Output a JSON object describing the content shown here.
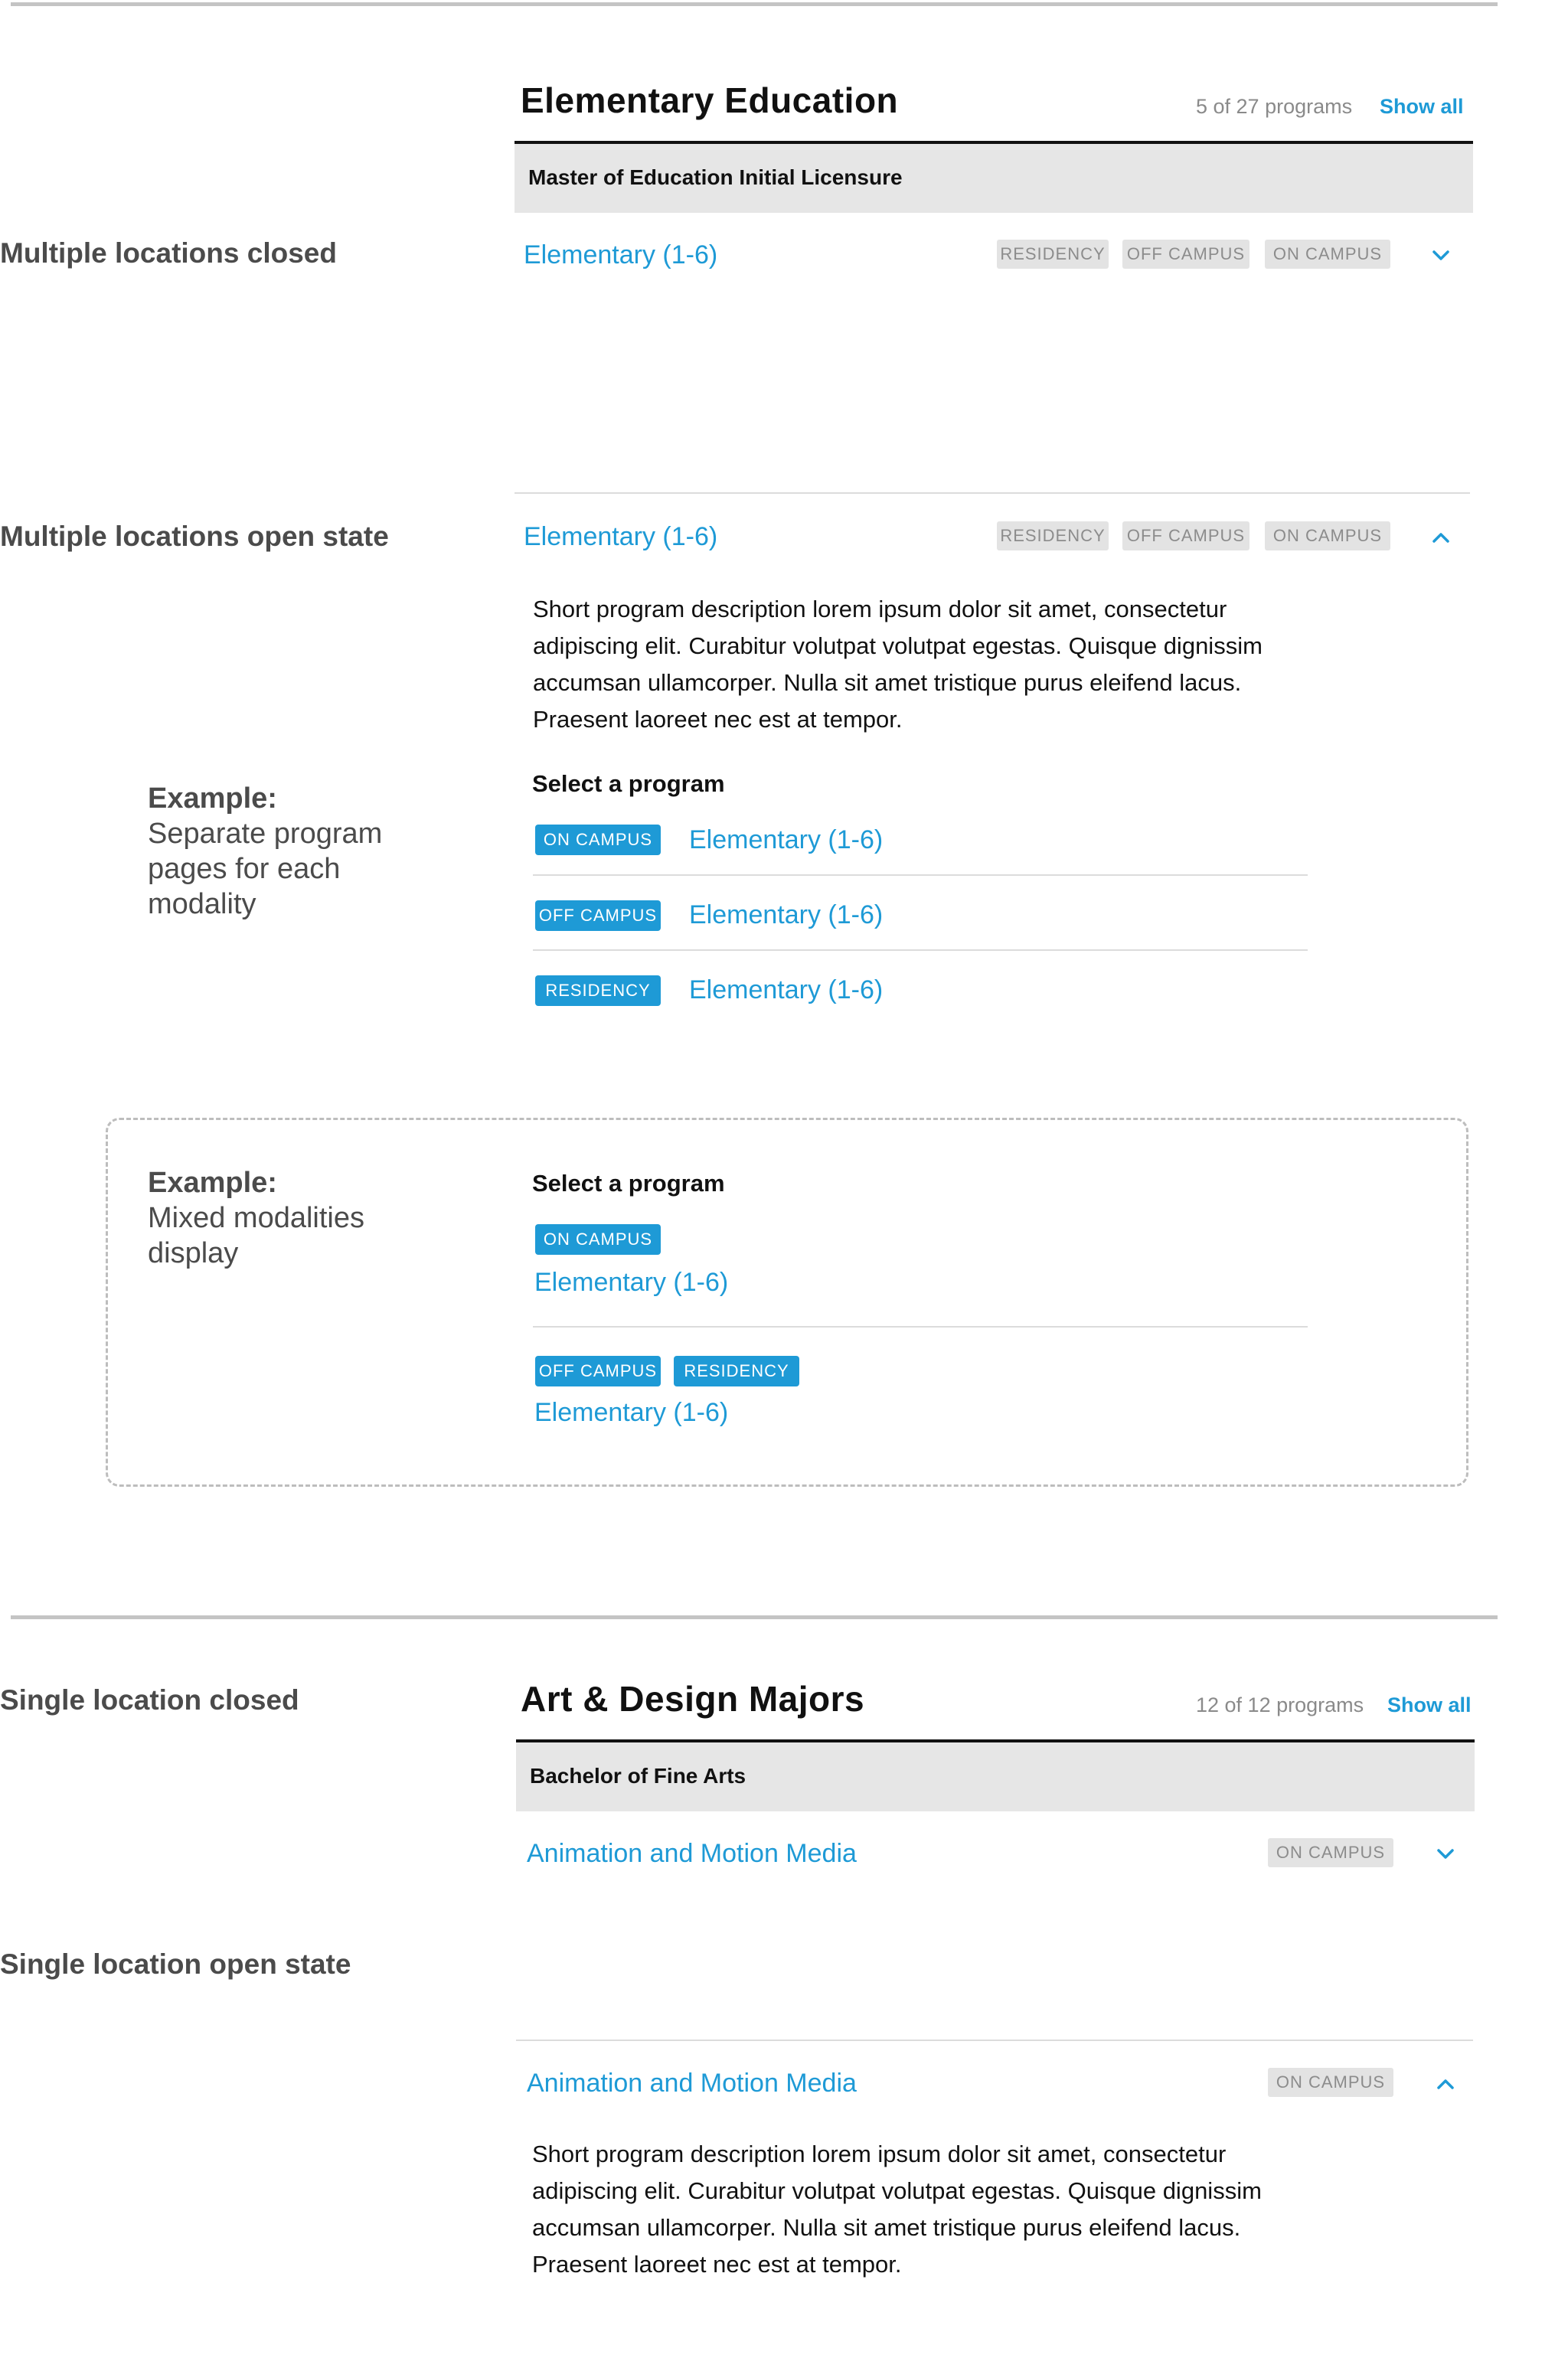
{
  "states": {
    "multi_closed": "Multiple locations closed",
    "multi_open": "Multiple locations open state",
    "single_closed": "Single location closed",
    "single_open": "Single location open state"
  },
  "examples": {
    "separate_title": "Example:",
    "separate_body": "Separate program pages for each modality",
    "mixed_title": "Example:",
    "mixed_body": "Mixed modalities display"
  },
  "section1": {
    "title": "Elementary Education",
    "count": "5 of 27 programs",
    "show_all": "Show all",
    "degree": "Master of Education Initial Licensure",
    "program": "Elementary (1-6)",
    "tags": [
      "RESIDENCY",
      "OFF CAMPUS",
      "ON CAMPUS"
    ],
    "description": "Short program description lorem ipsum dolor sit amet, consectetur adipiscing elit. Curabitur volutpat volutpat egestas. Quisque dignissim accumsan ullamcorper. Nulla sit amet tristique purus eleifend lacus. Praesent laoreet nec est at tempor.",
    "select_heading": "Select a program",
    "options": [
      {
        "tag": "ON CAMPUS",
        "label": "Elementary (1-6)"
      },
      {
        "tag": "OFF CAMPUS",
        "label": "Elementary (1-6)"
      },
      {
        "tag": "RESIDENCY",
        "label": "Elementary (1-6)"
      }
    ],
    "mixed_heading": "Select a program",
    "mixed": [
      {
        "tags": [
          "ON CAMPUS"
        ],
        "label": "Elementary (1-6)"
      },
      {
        "tags": [
          "OFF CAMPUS",
          "RESIDENCY"
        ],
        "label": "Elementary (1-6)"
      }
    ]
  },
  "section2": {
    "title": "Art & Design Majors",
    "count": "12 of 12 programs",
    "show_all": "Show all",
    "degree": "Bachelor of Fine Arts",
    "program": "Animation and Motion Media",
    "tag": "ON CAMPUS",
    "description": "Short program description lorem ipsum dolor sit amet, consectetur adipiscing elit. Curabitur volutpat volutpat egestas. Quisque dignissim accumsan ullamcorper. Nulla sit amet tristique purus eleifend lacus. Praesent laoreet nec est at tempor."
  },
  "colors": {
    "accent": "#1e9ad6",
    "tag_grey_bg": "#e3e3e3",
    "tag_grey_text": "#8c8c8c",
    "label_text": "#4b4b4b"
  },
  "icons": {
    "expand": "chevron-down-icon",
    "collapse": "chevron-up-icon"
  }
}
